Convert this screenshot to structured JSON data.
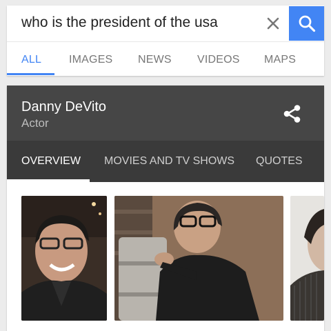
{
  "search": {
    "query": "who is the president of the usa"
  },
  "search_tabs": [
    {
      "label": "ALL",
      "active": true
    },
    {
      "label": "IMAGES",
      "active": false
    },
    {
      "label": "NEWS",
      "active": false
    },
    {
      "label": "VIDEOS",
      "active": false
    },
    {
      "label": "MAPS",
      "active": false
    }
  ],
  "knowledge_panel": {
    "name": "Danny DeVito",
    "subtitle": "Actor",
    "tabs": [
      {
        "label": "OVERVIEW",
        "active": true
      },
      {
        "label": "MOVIES AND TV SHOWS",
        "active": false
      },
      {
        "label": "QUOTES",
        "active": false
      }
    ]
  },
  "icons": {
    "clear": "close-icon",
    "search": "search-icon",
    "share": "share-icon"
  },
  "colors": {
    "accent": "#4285f4",
    "panel_header": "#464646",
    "panel_tabs": "#3a3a3a"
  }
}
